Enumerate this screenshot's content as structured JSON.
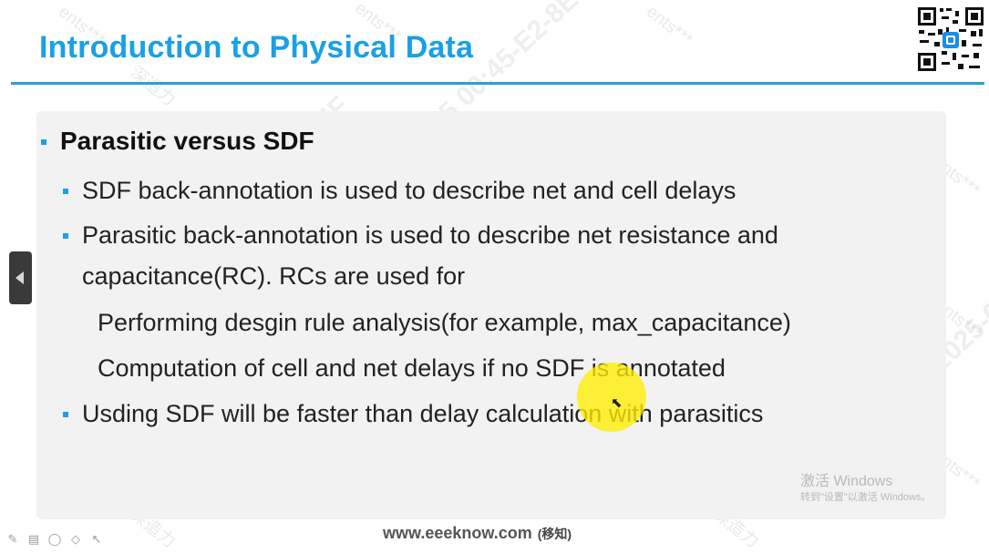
{
  "slide": {
    "title": "Introduction to Physical Data",
    "section_heading": "Parasitic versus SDF",
    "bullets": [
      "SDF back-annotation is used to describe net and cell delays",
      "Parasitic back-annotation is used to describe net resistance and",
      "capacitance(RC). RCs are used for",
      "Performing desgin rule analysis(for example, max_capacitance)",
      "Computation of cell and net delays if no SDF is annotated",
      "Usding SDF will be faster than delay calculation with parasitics"
    ]
  },
  "watermarks": {
    "user": "ents***",
    "brand": "深造力",
    "date_id": "2025-04-15 00:45-E2-8E-8A-4F"
  },
  "activation": {
    "line1": "激活 Windows",
    "line2": "转到\"设置\"以激活 Windows。"
  },
  "footer": {
    "site": "www.eeeknow.com",
    "site_sub": "(移知)"
  },
  "icons": {
    "prev": "chevron-left-icon",
    "qr": "qr-code-icon"
  }
}
